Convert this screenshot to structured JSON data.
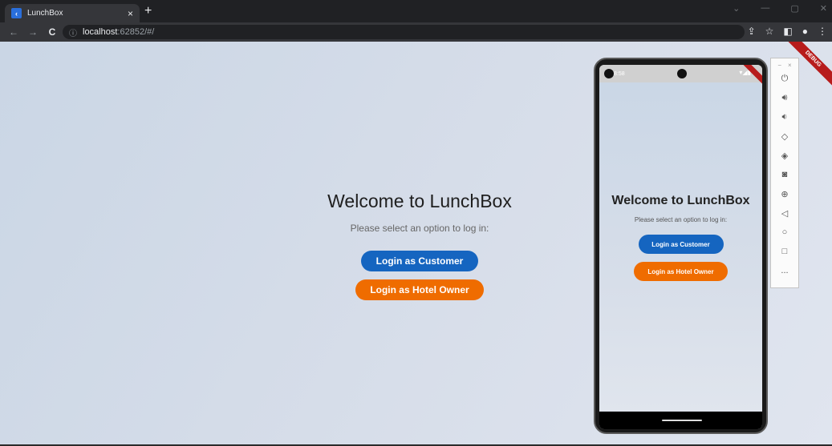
{
  "browser": {
    "tab_title": "LunchBox",
    "tab_close": "×",
    "new_tab": "+",
    "url_host": "localhost",
    "url_rest": ":62852/#/",
    "nav_back": "←",
    "nav_forward": "→",
    "nav_reload": "C",
    "win_minimize": "—",
    "win_restore": "▢",
    "win_close": "✕"
  },
  "page": {
    "debug_label": "DEBUG",
    "title": "Welcome to LunchBox",
    "subtitle": "Please select an option to log in:",
    "customer_button": "Login as Customer",
    "owner_button": "Login as Hotel Owner"
  },
  "phone": {
    "status_time": "8:58",
    "title": "Welcome to LunchBox",
    "subtitle": "Please select an option to log in:",
    "customer_button": "Login as Customer",
    "owner_button": "Login as Hotel Owner"
  },
  "emulator_toolbar": {
    "items": [
      "power-icon",
      "volume-up-icon",
      "volume-down-icon",
      "rotate-left-icon",
      "rotate-right-icon",
      "camera-icon",
      "zoom-icon",
      "back-icon",
      "home-icon",
      "overview-icon",
      "more-icon"
    ],
    "more_label": "..."
  },
  "colors": {
    "primary": "#1565c0",
    "accent": "#ef6c00",
    "debug": "#b71c1c"
  }
}
